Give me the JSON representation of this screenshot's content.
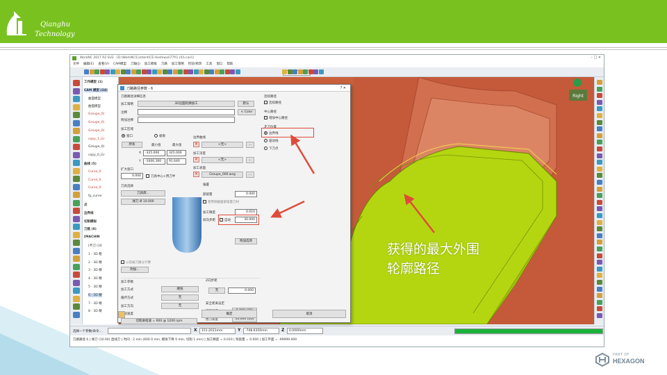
{
  "logo": {
    "line1": "Qianghu",
    "line2": "Technology"
  },
  "footer_logo": {
    "part_of": "PART OF",
    "name": "HEXAGON"
  },
  "annotation": {
    "line1": "获得的最大外围",
    "line2": "轮廓路径"
  },
  "app": {
    "title": "WorkNC 2017 R2 SU2 - [D:\\WorkNC\\Content\\CE-Hoshiwai\\77f\\1 (4)\\-cari\\]",
    "window_controls": "–  □  ✕",
    "menus": [
      "文件",
      "编辑(E)",
      "查看(V)",
      "CAM模型",
      "刀轴(J)",
      "加工模板",
      "刀路",
      "加工策略",
      "检验/修改",
      "工具",
      "窗口",
      "帮助"
    ],
    "toolbar_select": "1",
    "tree": [
      {
        "text": "工作模型 (1)",
        "style": "b"
      },
      {
        "text": "CAM 模型 (24)",
        "style": "b hl"
      },
      {
        "text": "曲面模型",
        "style": ""
      },
      {
        "text": "曲面模型",
        "style": ""
      },
      {
        "text": "Groupe_0(",
        "style": "red"
      },
      {
        "text": "Groupe_0(",
        "style": "red"
      },
      {
        "text": "Groupe_0(",
        "style": "red"
      },
      {
        "text": "copy_1_Gr",
        "style": "red"
      },
      {
        "text": "Groupe_0(",
        "style": ""
      },
      {
        "text": "copy_0_Gr",
        "style": ""
      },
      {
        "text": "曲线 (5)",
        "style": "b"
      },
      {
        "text": "Curve_0",
        "style": "red"
      },
      {
        "text": "Curve_0",
        "style": "red"
      },
      {
        "text": "Curve_0",
        "style": "red"
      },
      {
        "text": "fp_curve",
        "style": ""
      },
      {
        "text": "点",
        "style": "b"
      },
      {
        "text": "边界线",
        "style": "b"
      },
      {
        "text": "切削模拟",
        "style": "b"
      },
      {
        "text": "刀路 (8)",
        "style": "b"
      },
      {
        "text": "[MACHIN",
        "style": "b"
      },
      {
        "text": "[不刀 (10",
        "style": ""
      },
      {
        "text": "1 - 3D 粗",
        "style": ""
      },
      {
        "text": "2 - 3D 精",
        "style": ""
      },
      {
        "text": "3 - 3D 精",
        "style": ""
      },
      {
        "text": "4 - 3D 精",
        "style": ""
      },
      {
        "text": "5 - 3D 精",
        "style": ""
      },
      {
        "text": "6 - 3D 精",
        "style": "hl"
      },
      {
        "text": "7 - 3D 精",
        "style": ""
      },
      {
        "text": "8 - 3D 精",
        "style": ""
      }
    ],
    "view_cube_label": "Right",
    "status": {
      "prompt": "选择一个参数/命令...",
      "x_label": "X",
      "x_value": "151.2011mm",
      "y_label": "Y",
      "y_value": "-748.6350mm",
      "z_label": "Z",
      "z_value": "0.0000mm",
      "progress": 1.0
    },
    "info_text": "刀路路径 6 | 球刀 (10.00) 直线刀 | 时间 : 2 min (600 0 min, 模拟下降 0 min, 切削 1 min) | 加工精度 = 0.010 | 残留量 = 0.000 | 加工平面 = -99999.000"
  },
  "dialog": {
    "title": "刀路路径参数 - 6",
    "controls": "?  ✕",
    "section_info": "刀路路径详细信息",
    "strategy_label": "加工策略",
    "strategy_value": "3D沿面轮廓加工",
    "default_btn": "默认",
    "comment_label": "注释",
    "color_btn": "< Color",
    "extra_comment_label": "附加注释",
    "zone_section": "加工区域",
    "zone_all": "窗口",
    "zone_limit": "极限",
    "all_btn": "所有",
    "min_label": "最小值",
    "max_label": "最大值",
    "x_label": "X",
    "x_min": "-325.000",
    "x_max": "325.000",
    "y_label": "Y",
    "y_min": "-1006.360",
    "y_max": "91.640",
    "boundary_label": "边界曲线",
    "none1": "<无>",
    "depth_label": "加工深度",
    "none2": "<无>",
    "surface_label": "加工表面",
    "surface_value": "Groupe_000.wsg",
    "expand_section": "扩大窗口",
    "expand_value": "0.000",
    "expand_check": "刀具中心+用刀半",
    "tool_section": "刀具选择",
    "tool_lib_btn": "刀具库...",
    "tool_value": "球刀 Ø 10.000",
    "offset_section": "偏置",
    "allowance_label": "部留量",
    "allowance_value": "0.000",
    "use_prev": "使用刚截面部留量刀材",
    "tolerance_label": "加工精度",
    "tolerance_value": "0.010",
    "slope_label": "斜向步距",
    "slope_check": "自动",
    "slope_value": "30.000",
    "adv_btn": "附加选项",
    "use_prev_path": "以前被刀路分计算",
    "attach_btn": "附加...",
    "params_section": "加工参数",
    "mode_label": "加工方式",
    "mode_value": "顺铣",
    "loop_label": "循环方式",
    "loop_value": "无",
    "dir_label": "加工方向",
    "dir_value": "无",
    "feed_section": "切削速度",
    "feed_value": "切削进给速 = 600 @ 1200 rpm",
    "three_d_check": "3D 刀具补偿",
    "z_step_section": "Z向步距",
    "z_step_btn": "无",
    "z_step_value": "0.000",
    "safety_section": "安全距离设定",
    "safe_height_label": "缓降高度",
    "safe_height_value": "6.000 (3D)",
    "lift_label": "抬刀高度",
    "lift_value": "10.000 (2D)",
    "cut_label": "切入/切出",
    "cut_value": "垂直下刀",
    "right_path_title": "连续路径",
    "right_path_check": "连续路径",
    "center_title": "中心路径",
    "center_check": "增加中心路径",
    "pos_title": "走刀位置",
    "pos_opt1": "边界线",
    "pos_opt2": "驱动线",
    "pos_opt3": "下刀点",
    "ok_btn": "确定",
    "cancel_btn": "取消"
  },
  "colors": {
    "banner": "#78c11f",
    "part_green": "#b3d610",
    "part_orange": "#c8603c",
    "arrow": "#e04a3a"
  }
}
